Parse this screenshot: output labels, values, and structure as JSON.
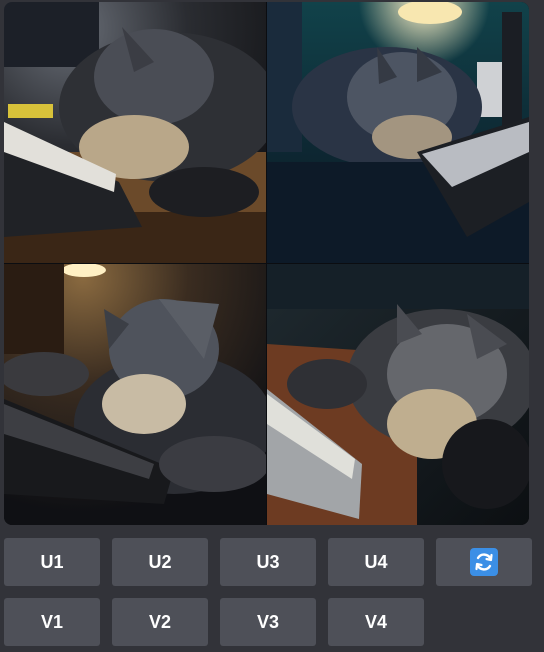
{
  "image_grid": {
    "tiles": [
      {
        "subject": "schnauzer sleeping next to keyboard, desk lamp light"
      },
      {
        "subject": "schnauzer resting head on keyboard, teal wall background"
      },
      {
        "subject": "schnauzer lying on keyboard, warm lamp light"
      },
      {
        "subject": "schnauzer sleeping beside white keyboard on desk"
      }
    ]
  },
  "buttons": {
    "upscale": [
      "U1",
      "U2",
      "U3",
      "U4"
    ],
    "variation": [
      "V1",
      "V2",
      "V3",
      "V4"
    ],
    "reroll_icon": "refresh-icon",
    "reroll_color": "#3b8fe6"
  }
}
